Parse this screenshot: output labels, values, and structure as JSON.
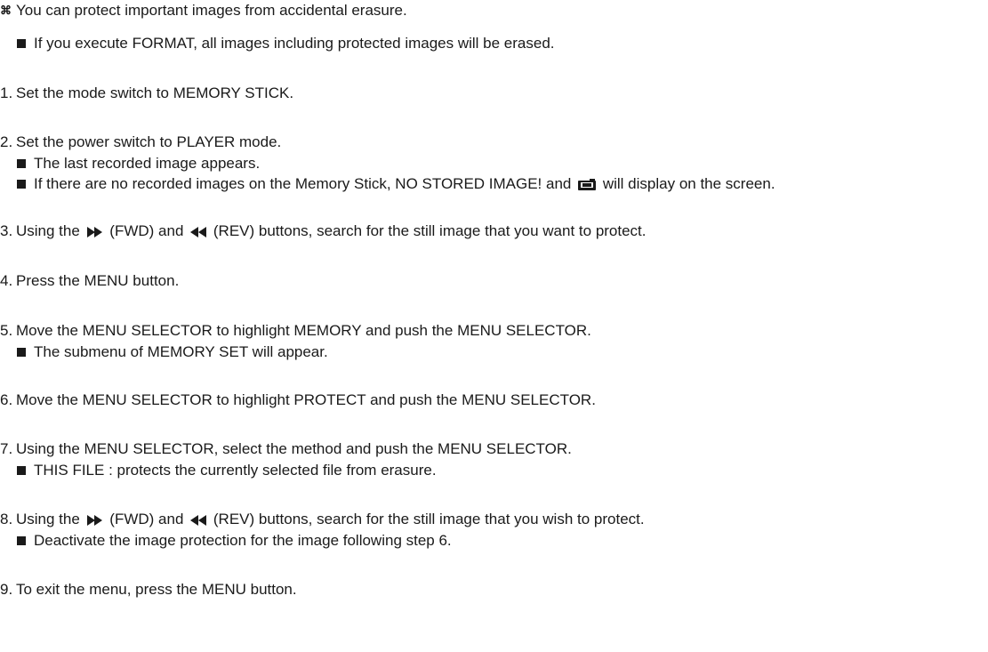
{
  "intro": {
    "mark": "⌘",
    "text": "You can protect important images from accidental erasure.",
    "note": "If you execute FORMAT, all images including protected images will be erased."
  },
  "steps": [
    {
      "num": "1.",
      "text": "Set the mode switch to MEMORY STICK."
    },
    {
      "num": "2.",
      "text": "Set the power switch to PLAYER mode.",
      "notes": [
        "The last recorded image appears.",
        "If there are no recorded images on the Memory Stick, NO STORED IMAGE! and",
        "will display on the screen."
      ]
    },
    {
      "num": "3.",
      "text_a": "Using the",
      "text_b": "(FWD) and",
      "text_c": "(REV) buttons, search for the still image that you want to protect."
    },
    {
      "num": "4.",
      "text": "Press the MENU button."
    },
    {
      "num": "5.",
      "text": "Move the MENU SELECTOR to highlight MEMORY and push the MENU SELECTOR.",
      "notes": [
        "The submenu of MEMORY SET will appear."
      ]
    },
    {
      "num": "6.",
      "text": "Move the MENU SELECTOR to highlight PROTECT and push the MENU SELECTOR."
    },
    {
      "num": "7.",
      "text": "Using the MENU SELECTOR, select the method and push the MENU SELECTOR.",
      "notes": [
        "THIS FILE : protects the currently selected file from erasure."
      ]
    },
    {
      "num": "8.",
      "text_a": "Using the",
      "text_b": "(FWD) and",
      "text_c": "(REV) buttons, search for the still image that you wish to protect.",
      "notes": [
        "Deactivate the image protection for the image following step 6."
      ]
    },
    {
      "num": "9.",
      "text": "To exit the menu, press the MENU button."
    }
  ],
  "icons": {
    "fwd": "fast-forward-icon",
    "rev": "rewind-icon",
    "memory_stick": "memory-stick-icon",
    "bullet": "square-bullet-icon"
  }
}
